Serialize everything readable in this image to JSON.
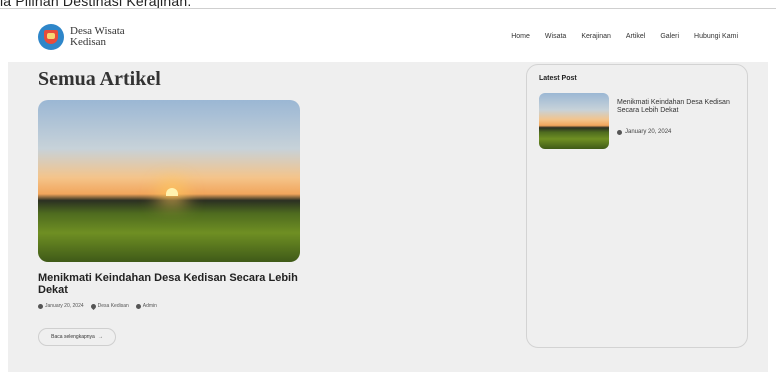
{
  "top_strip_text": "ia Pilihan Destinasi Kerajinan.",
  "brand": {
    "line1": "Desa Wisata",
    "line2": "Kedisan"
  },
  "nav": {
    "items": [
      "Home",
      "Wisata",
      "Kerajinan",
      "Artikel",
      "Galeri",
      "Hubungi Kami"
    ]
  },
  "page": {
    "title": "Semua Artikel"
  },
  "article": {
    "title": "Menikmati Keindahan Desa Kedisan Secara Lebih Dekat",
    "date": "January 20, 2024",
    "location": "Desa Kedisan",
    "author": "Admin",
    "read_more": "Baca selengkapnya",
    "read_more_arrow": "→"
  },
  "sidebar": {
    "title": "Latest Post",
    "item": {
      "title": "Menikmati Keindahan Desa Kedisan Secara Lebih Dekat",
      "date": "January 20, 2024"
    }
  },
  "icons": {
    "logo": "village-logo-icon",
    "clock": "clock-icon",
    "pin": "location-pin-icon",
    "user": "user-icon"
  }
}
